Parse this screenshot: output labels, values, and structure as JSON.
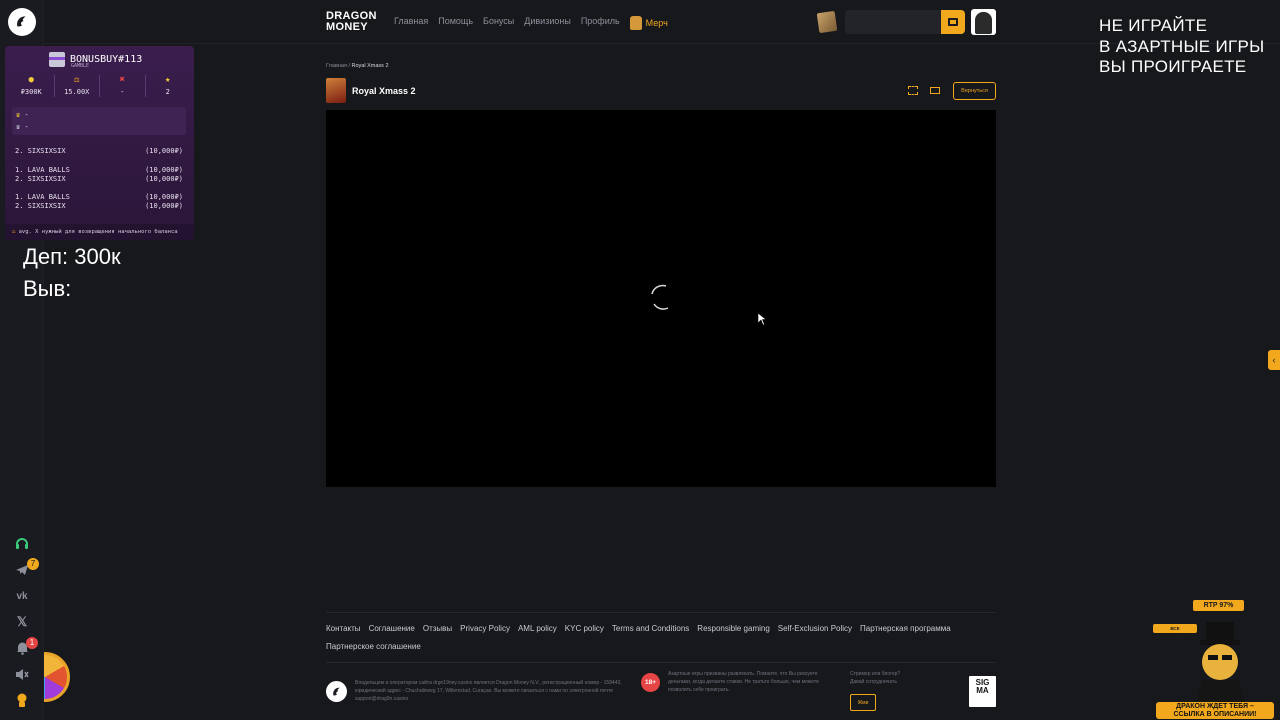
{
  "brand": {
    "line1": "DRAGON",
    "line2": "MONEY"
  },
  "nav": {
    "items": [
      "Главная",
      "Помощь",
      "Бонусы",
      "Дивизионы",
      "Профиль"
    ],
    "merch": "Мерч"
  },
  "warning": {
    "lines": [
      "НЕ ИГРАЙТЕ",
      "В АЗАРТНЫЕ ИГРЫ",
      "ВЫ ПРОИГРАЕТЕ"
    ]
  },
  "bonusbuy": {
    "title": "BONUSBUY#113",
    "subtitle": "GAMBLE",
    "stats": [
      {
        "icon": "●",
        "value": "₽300K"
      },
      {
        "icon": "⚖",
        "value": "15.00X"
      },
      {
        "icon": "✖",
        "value": "-"
      },
      {
        "icon": "★",
        "value": "2"
      }
    ],
    "crowns": [
      {
        "icon": "♛",
        "value": "-"
      },
      {
        "icon": "♛",
        "value": "-"
      }
    ],
    "group1": [
      {
        "name": "2. SIXSIXSIX",
        "amount": "(10,000₽)"
      }
    ],
    "group2": [
      {
        "name": "1. LAVA BALLS",
        "amount": "(10,000₽)"
      },
      {
        "name": "2. SIXSIXSIX",
        "amount": "(10,000₽)"
      }
    ],
    "group3": [
      {
        "name": "1. LAVA BALLS",
        "amount": "(10,000₽)"
      },
      {
        "name": "2. SIXSIXSIX",
        "amount": "(10,000₽)"
      }
    ],
    "footer": "avg. X нужный для возвращения начального баланса"
  },
  "deposit": {
    "dep": "Деп: 300к",
    "vyv": "Выв:"
  },
  "breadcrumb": {
    "home": "Главная",
    "sep": "/",
    "current": "Royal Xmass 2"
  },
  "game": {
    "title": "Royal Xmass 2",
    "back": "Вернуться"
  },
  "sidebar": {
    "telegram_badge": "7",
    "bell_badge": "1"
  },
  "mascot": {
    "rtp": "RTP 97%",
    "tag": "ВСЕ ВОЗМОЖНОСТИ",
    "banner_line1": "ДРАКОН ЖДЕТ ТЕБЯ –",
    "banner_line2": "ССЫЛКА В ОПИСАНИИ!"
  },
  "footer": {
    "links": [
      "Контакты",
      "Соглашение",
      "Отзывы",
      "Privacy Policy",
      "AML policy",
      "KYC policy",
      "Terms and Conditions",
      "Responsible gaming",
      "Self-Exclusion Policy",
      "Партнерская программа",
      "Партнерское соглашение"
    ],
    "legal": "Владельцем и оператором сайта drgn19ney.casino является Dragon Money N.V., регистрационный номер - 158443, юридический адрес - Chuchubiweg 17, Willemstad, Curaçao. Вы можете связаться с нами по электронной почте support@drag0n.casino",
    "age": "18+",
    "warning_text": "Азартные игры призваны развлекать. Помните, что Вы рискуете деньгами, когда делаете ставки. Не тратьте больше, чем можете позволить себе проиграть.",
    "streamer_line1": "Стример или блогер?",
    "streamer_line2": "Давай сотрудничать",
    "write": "Жми",
    "sigma_line1": "SIG",
    "sigma_line2": "MA"
  },
  "colors": {
    "accent": "#f2a81d",
    "bg": "#17181c",
    "widget": "#3a1d4d",
    "danger": "#e64545"
  }
}
